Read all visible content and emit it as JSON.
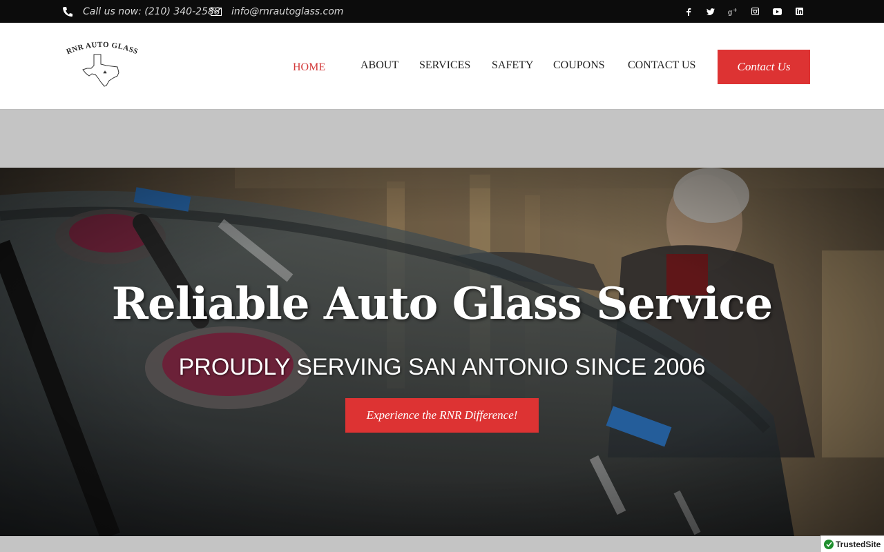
{
  "topbar": {
    "phone_text": "Call us now: (210) 340-2588",
    "email_text": "info@rnrautoglass.com",
    "social": [
      "facebook-icon",
      "twitter-icon",
      "google-plus-icon",
      "instagram-icon",
      "youtube-icon",
      "linkedin-icon"
    ]
  },
  "header": {
    "logo_text": "RNR AUTO GLASS",
    "nav": [
      {
        "label": "HOME",
        "active": true
      },
      {
        "label": "ABOUT"
      },
      {
        "label": "SERVICES"
      },
      {
        "label": "SAFETY"
      },
      {
        "label": "COUPONS"
      },
      {
        "label": "CONTACT US"
      }
    ],
    "cta_label": "Contact Us"
  },
  "hero": {
    "title": "Reliable Auto Glass Service",
    "subtitle": "PROUDLY SERVING SAN ANTONIO SINCE 2006",
    "button_label": "Experience the RNR Difference!"
  },
  "badge": {
    "text": "TrustedSite"
  },
  "colors": {
    "accent": "#dd3333",
    "topbar_bg": "#0c0c0c"
  }
}
